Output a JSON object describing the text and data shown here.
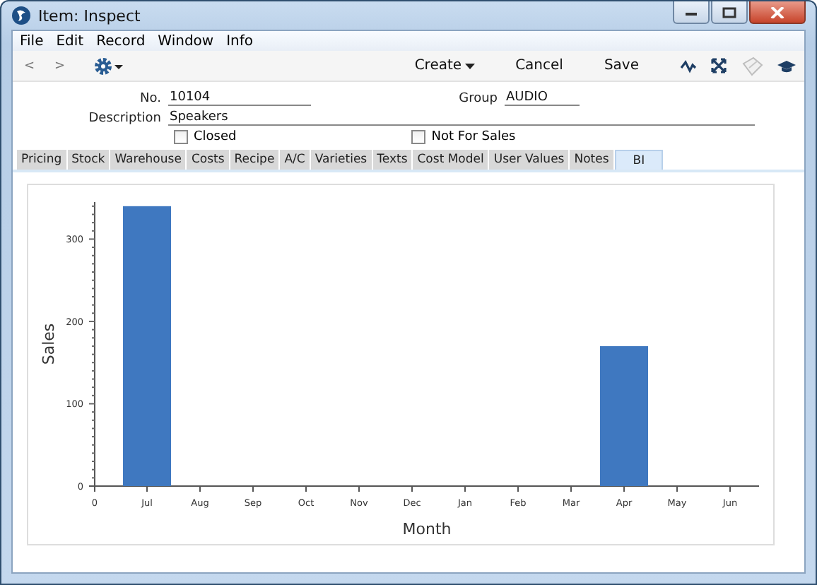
{
  "window": {
    "title": "Item: Inspect"
  },
  "menu": [
    "File",
    "Edit",
    "Record",
    "Window",
    "Info"
  ],
  "toolbar": {
    "back": "<",
    "forward": ">",
    "buttons": [
      {
        "label": "Create",
        "kind": "dropdown"
      },
      {
        "label": "Cancel",
        "kind": "plain"
      },
      {
        "label": "Save",
        "kind": "plain"
      }
    ],
    "icons": [
      {
        "kind": "pulse",
        "disabled": false
      },
      {
        "kind": "expand",
        "disabled": false
      },
      {
        "kind": "note",
        "disabled": true
      },
      {
        "kind": "cap",
        "disabled": false
      }
    ]
  },
  "form": {
    "no": {
      "label": "No.",
      "value": "10104"
    },
    "group": {
      "label": "Group",
      "value": "AUDIO"
    },
    "description": {
      "label": "Description",
      "value": "Speakers"
    },
    "checkboxes": [
      {
        "label": "Closed",
        "checked": false
      },
      {
        "label": "Not For Sales",
        "checked": false
      }
    ]
  },
  "tabs": [
    {
      "label": "Pricing",
      "selected": false
    },
    {
      "label": "Stock",
      "selected": false
    },
    {
      "label": "Warehouse",
      "selected": false
    },
    {
      "label": "Costs",
      "selected": false
    },
    {
      "label": "Recipe",
      "selected": false
    },
    {
      "label": "A/C",
      "selected": false
    },
    {
      "label": "Varieties",
      "selected": false
    },
    {
      "label": "Texts",
      "selected": false
    },
    {
      "label": "Cost Model",
      "selected": false
    },
    {
      "label": "User Values",
      "selected": false
    },
    {
      "label": "Notes",
      "selected": false
    },
    {
      "label": "BI",
      "selected": true
    }
  ],
  "chart_data": {
    "type": "bar",
    "xlabel": "Month",
    "ylabel": "Sales",
    "categories": [
      "Jul",
      "Aug",
      "Sep",
      "Oct",
      "Nov",
      "Dec",
      "Jan",
      "Feb",
      "Mar",
      "Apr",
      "May",
      "Jun"
    ],
    "values": [
      340,
      0,
      0,
      0,
      0,
      0,
      0,
      0,
      0,
      170,
      0,
      0
    ],
    "ylim": [
      0,
      345
    ],
    "yticks": [
      0,
      100,
      200,
      300
    ]
  },
  "chart_origin_label": "0"
}
